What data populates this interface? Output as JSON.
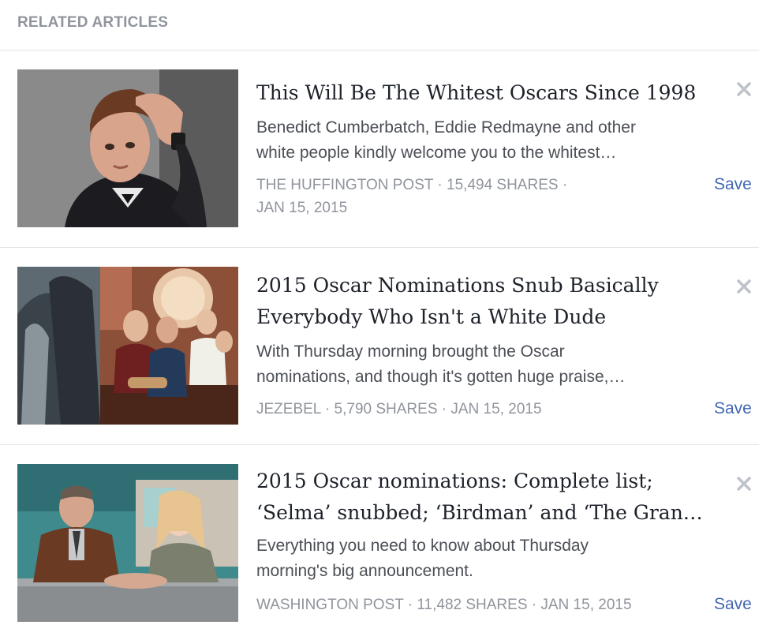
{
  "header": {
    "title": "RELATED ARTICLES"
  },
  "articles": [
    {
      "title_lines": [
        "This Will Be The Whitest Oscars Since 1998"
      ],
      "snippet_lines": [
        "Benedict Cumberbatch, Eddie Redmayne and other",
        "white people kindly welcome you to the whitest…"
      ],
      "meta_lines": [
        "THE HUFFINGTON POST · 15,494 SHARES ·",
        "JAN 15, 2015"
      ],
      "save_label": "Save",
      "thumbnail": "portrait-photo",
      "close_icon": "close-icon"
    },
    {
      "title_lines": [
        "2015 Oscar Nominations Snub Basically",
        "Everybody Who Isn't a White Dude"
      ],
      "snippet_lines": [
        "With Thursday morning brought the Oscar",
        "nominations, and though it's gotten huge praise,…"
      ],
      "meta_lines": [
        "JEZEBEL · 5,790 SHARES · JAN 15, 2015"
      ],
      "save_label": "Save",
      "thumbnail": "film-collage-photo",
      "close_icon": "close-icon"
    },
    {
      "title_lines": [
        "2015 Oscar nominations: Complete list;",
        "‘Selma’ snubbed; ‘Birdman’ and ‘The Grand…"
      ],
      "snippet_lines": [
        "Everything you need to know about Thursday",
        "morning's big announcement."
      ],
      "meta_lines": [
        "WASHINGTON POST · 11,482 SHARES · JAN 15, 2015"
      ],
      "save_label": "Save",
      "thumbnail": "film-scene-photo",
      "close_icon": "close-icon"
    }
  ],
  "colors": {
    "header_text": "#90949c",
    "title_text": "#1d2129",
    "snippet_text": "#4b4f56",
    "meta_text": "#90949c",
    "save_link": "#4267b2",
    "divider": "#e1e2e5"
  }
}
